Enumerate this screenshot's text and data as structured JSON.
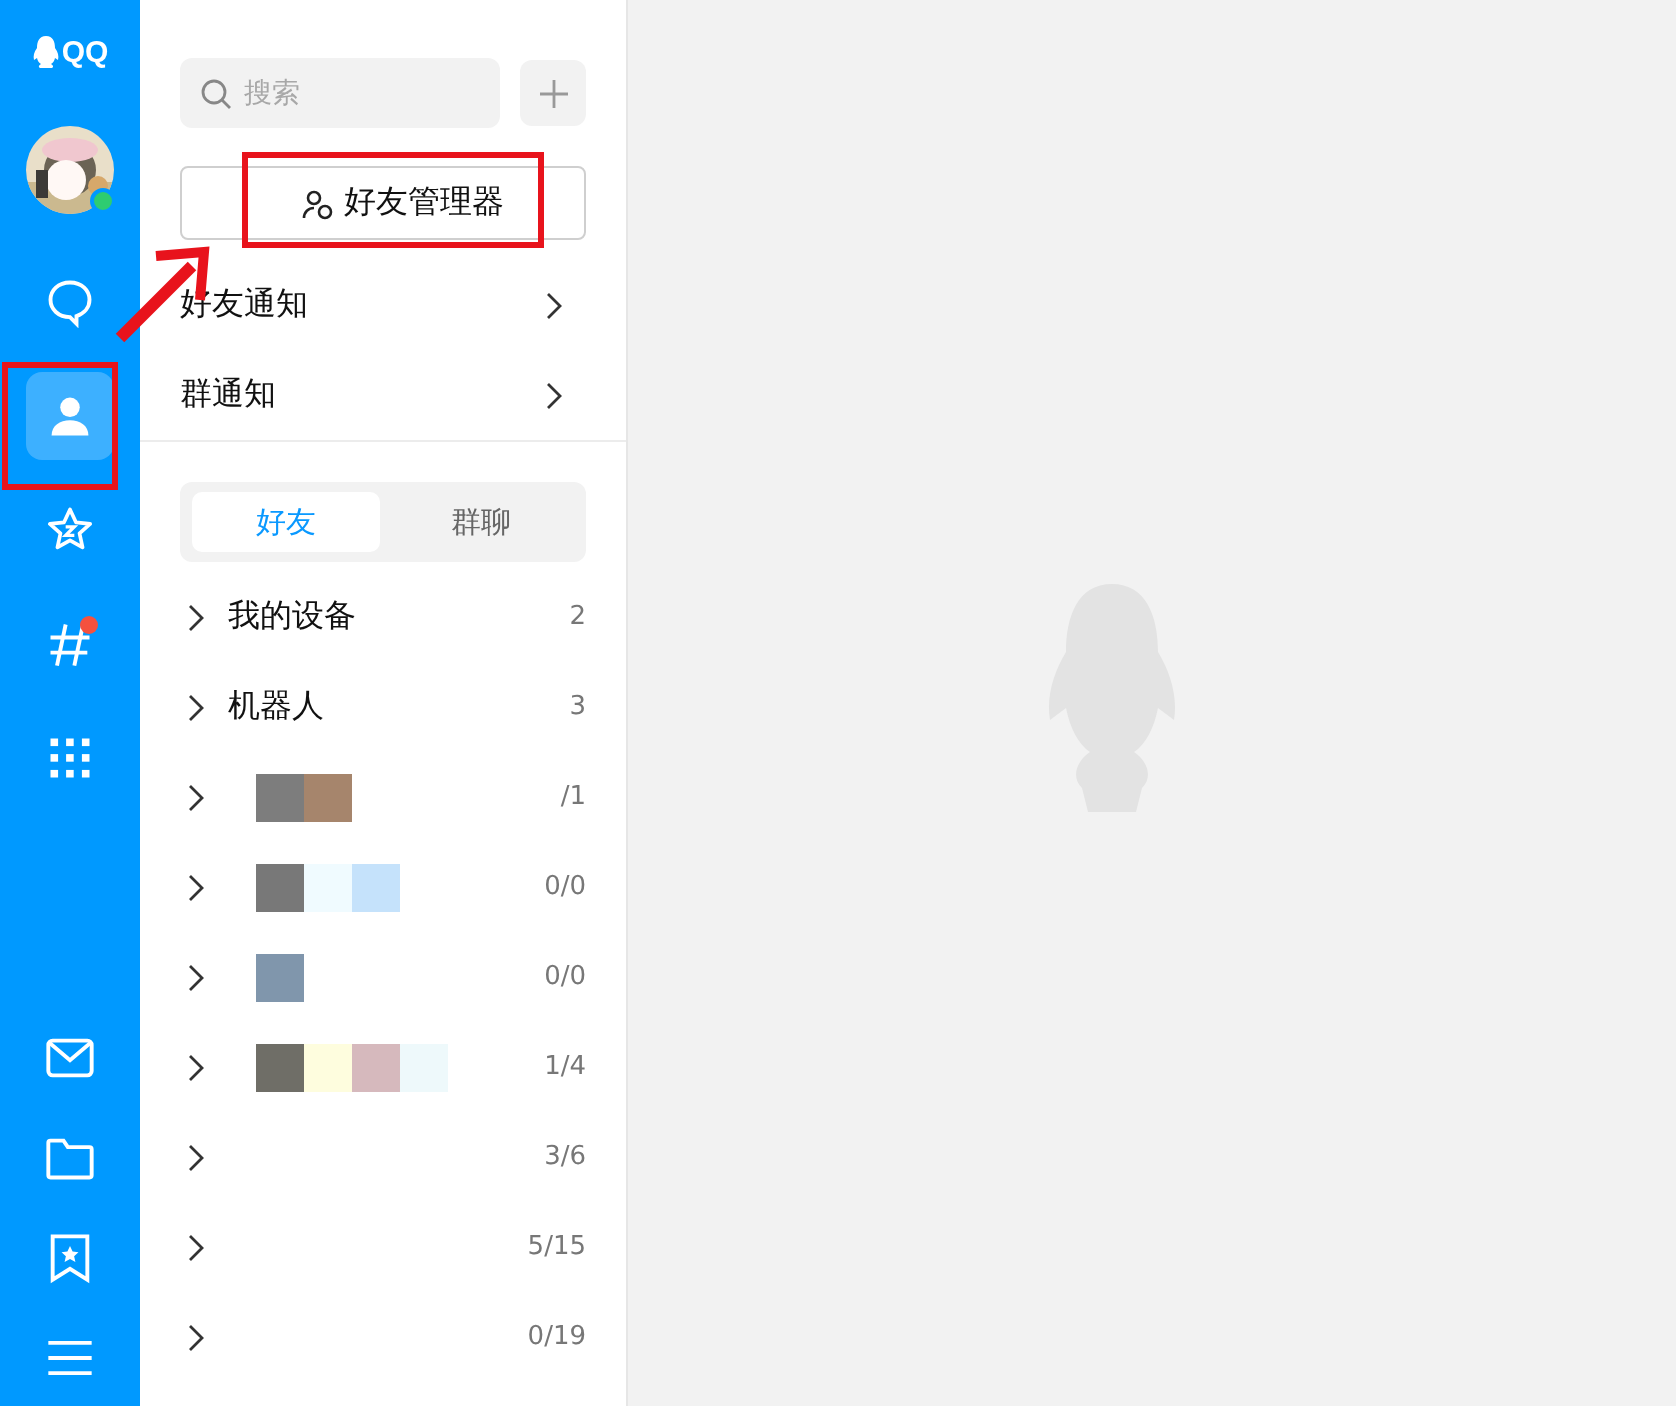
{
  "nav": {
    "logo_text": "QQ",
    "avatar": {
      "online": true
    },
    "top_items": [
      {
        "kind": "chat",
        "selected": false,
        "badge": false
      },
      {
        "kind": "contacts",
        "selected": true,
        "badge": false
      },
      {
        "kind": "zone",
        "selected": false,
        "badge": false
      },
      {
        "kind": "channel",
        "selected": false,
        "badge": true
      },
      {
        "kind": "apps",
        "selected": false,
        "badge": false
      }
    ],
    "bottom_items": [
      {
        "kind": "mail",
        "selected": false,
        "badge": false
      },
      {
        "kind": "folder",
        "selected": false,
        "badge": false
      },
      {
        "kind": "favorites",
        "selected": false,
        "badge": false
      },
      {
        "kind": "menu",
        "selected": false,
        "badge": false
      }
    ]
  },
  "contacts": {
    "search": {
      "placeholder": "搜索"
    },
    "manager_button": "好友管理器",
    "notices": [
      "好友通知",
      "群通知"
    ],
    "tabs": [
      {
        "label": "好友",
        "selected": true
      },
      {
        "label": "群聊",
        "selected": false
      }
    ],
    "groups": [
      {
        "kind": "named",
        "name": "我的设备",
        "count": "2"
      },
      {
        "kind": "named",
        "name": "机器人",
        "count": "3"
      },
      {
        "kind": "blurred",
        "count": "/1"
      },
      {
        "kind": "blurred",
        "count": "0/0"
      },
      {
        "kind": "blurred",
        "count": "0/0"
      },
      {
        "kind": "blurred",
        "count": "1/4"
      },
      {
        "kind": "blurred",
        "count": "3/6"
      },
      {
        "kind": "blurred",
        "count": "5/15"
      },
      {
        "kind": "blurred",
        "count": "0/19"
      }
    ]
  }
}
